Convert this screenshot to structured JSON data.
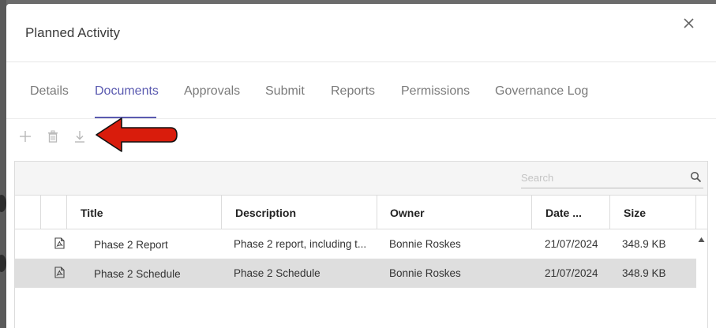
{
  "dialog": {
    "title": "Planned Activity",
    "close_icon": "close-icon"
  },
  "tabs": [
    {
      "label": "Details",
      "active": false
    },
    {
      "label": "Documents",
      "active": true
    },
    {
      "label": "Approvals",
      "active": false
    },
    {
      "label": "Submit",
      "active": false
    },
    {
      "label": "Reports",
      "active": false
    },
    {
      "label": "Permissions",
      "active": false
    },
    {
      "label": "Governance Log",
      "active": false
    }
  ],
  "toolbar": {
    "add_icon": "plus-icon",
    "delete_icon": "trash-icon",
    "download_icon": "download-icon",
    "annotation": "red-arrow-pointing-left"
  },
  "grid": {
    "search_placeholder": "Search",
    "columns": {
      "title": "Title",
      "description": "Description",
      "owner": "Owner",
      "date": "Date ...",
      "size": "Size"
    },
    "rows": [
      {
        "icon": "pdf-file-icon",
        "title": "Phase 2 Report",
        "description": "Phase 2 report, including t...",
        "owner": "Bonnie Roskes",
        "date": "21/07/2024",
        "size": "348.9 KB",
        "selected": false
      },
      {
        "icon": "pdf-file-icon",
        "title": "Phase 2 Schedule",
        "description": "Phase 2 Schedule",
        "owner": "Bonnie Roskes",
        "date": "21/07/2024",
        "size": "348.9 KB",
        "selected": true
      }
    ]
  },
  "colors": {
    "accent": "#5a5ab0",
    "arrow_fill": "#d91c0c",
    "selected_row": "#dedede"
  }
}
